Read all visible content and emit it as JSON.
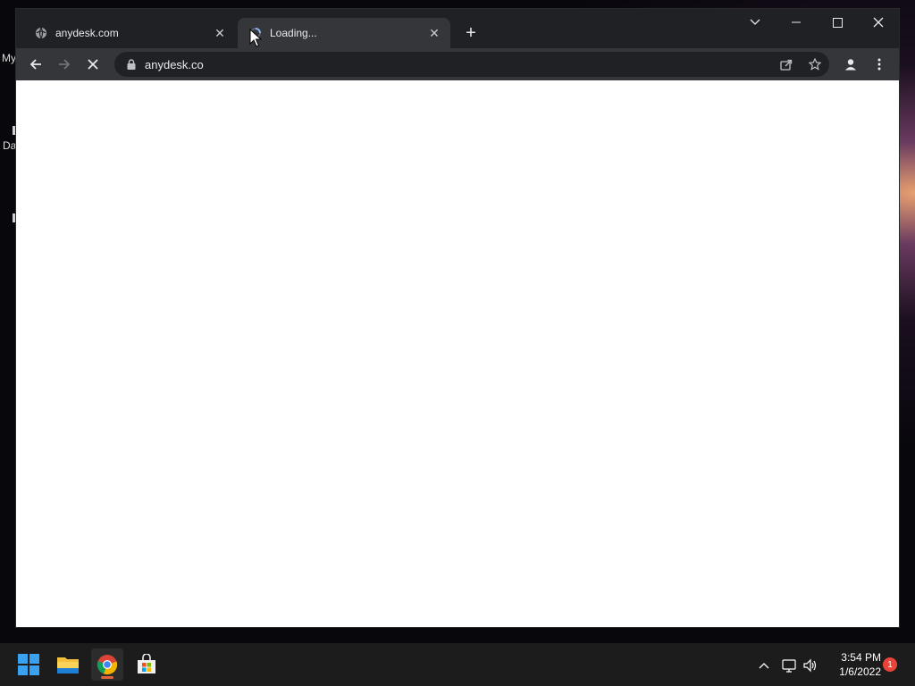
{
  "desktop": {
    "labels": [
      "My",
      "Da"
    ]
  },
  "browser": {
    "tabs": [
      {
        "title": "anydesk.com",
        "favicon": "globe-icon",
        "active": false
      },
      {
        "title": "Loading...",
        "favicon": "loading-spinner-icon",
        "active": true
      }
    ],
    "new_tab_icon": "plus-icon",
    "window_controls": [
      "tab-search-icon",
      "minimize-icon",
      "maximize-icon",
      "close-icon"
    ],
    "toolbar": {
      "back_icon": "back-arrow-icon",
      "forward_icon": "forward-arrow-icon",
      "stop_icon": "stop-icon",
      "url": "anydesk.co",
      "lock_icon": "lock-icon",
      "share_icon": "share-icon",
      "bookmark_icon": "star-icon",
      "profile_icon": "profile-icon",
      "menu_icon": "kebab-menu-icon"
    }
  },
  "taskbar": {
    "apps": [
      "windows-start-icon",
      "file-explorer-icon",
      "chrome-icon",
      "microsoft-store-icon"
    ],
    "tray_icons": [
      "chevron-up-icon",
      "network-icon",
      "volume-icon"
    ],
    "time": "3:54 PM",
    "date": "1/6/2022",
    "notification_count": "1",
    "accent_color": "#e0663a"
  }
}
